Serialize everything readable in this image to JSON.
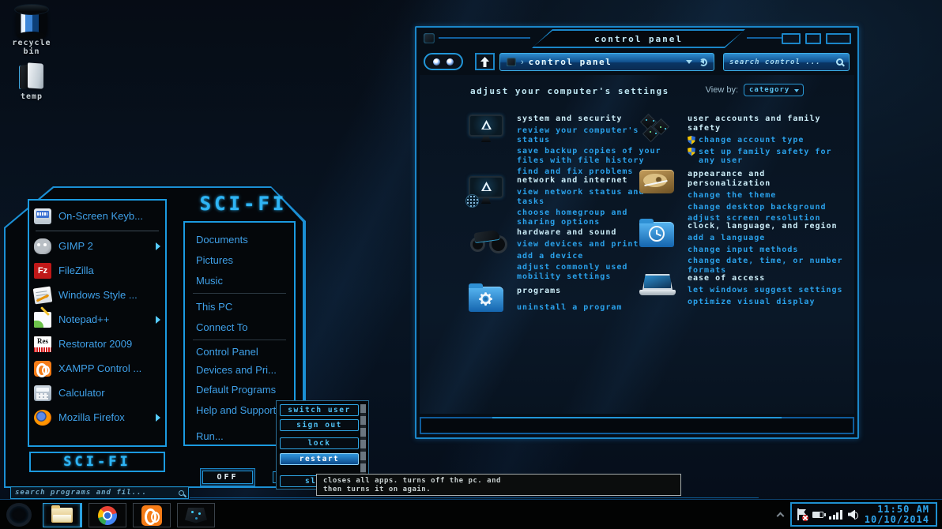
{
  "colors": {
    "accent": "#1e96d8",
    "link": "#2aa1ea",
    "category_title": "#cdeef9",
    "menu_text": "#3fa0e8"
  },
  "desktop": {
    "icons": [
      {
        "label": "recycle bin"
      },
      {
        "label": "temp"
      }
    ]
  },
  "start_menu": {
    "logo": "SCI-FI",
    "footer_logo": "SCI-FI",
    "off_button": "OFF",
    "search_placeholder": "search programs and fil...",
    "programs": [
      {
        "label": "On-Screen Keyb...",
        "icon": "on-screen-keyboard-icon",
        "has_submenu": false
      },
      {
        "label": "GIMP 2",
        "icon": "gimp-icon",
        "has_submenu": true
      },
      {
        "label": "FileZilla",
        "icon": "filezilla-icon",
        "has_submenu": false
      },
      {
        "label": "Windows Style ...",
        "icon": "windows-style-icon",
        "has_submenu": false
      },
      {
        "label": "Notepad++",
        "icon": "notepad-plus-plus-icon",
        "has_submenu": true
      },
      {
        "label": "Restorator 2009",
        "icon": "restorator-icon",
        "has_submenu": false
      },
      {
        "label": "XAMPP Control ...",
        "icon": "xampp-icon",
        "has_submenu": false
      },
      {
        "label": "Calculator",
        "icon": "calculator-icon",
        "has_submenu": false
      },
      {
        "label": "Mozilla Firefox",
        "icon": "firefox-icon",
        "has_submenu": true
      }
    ],
    "places": [
      "Documents",
      "Pictures",
      "Music",
      "This PC",
      "Connect To",
      "Control Panel",
      "Devices and Pri...",
      "Default Programs",
      "Help and Support",
      "Run..."
    ]
  },
  "power_menu": {
    "items": [
      "switch user",
      "sign out",
      "lock",
      "restart",
      "sleep"
    ],
    "highlighted": "restart"
  },
  "tooltip": {
    "text": "closes all apps. turns off the pc. and then turns it on again."
  },
  "control_panel": {
    "title": "control panel",
    "address": "control panel",
    "search_placeholder": "search control ...",
    "header": "adjust your computer's settings",
    "view_by_label": "View by:",
    "view_by_value": "category",
    "categories_left": [
      {
        "title": "system and security",
        "icon": "monitor-shield-icon",
        "links": [
          "review your computer's status",
          "save backup copies of your files with file history",
          "find and fix problems"
        ]
      },
      {
        "title": "network and internet",
        "icon": "monitor-globe-icon",
        "links": [
          "view network status and tasks",
          "choose homegroup and sharing options"
        ]
      },
      {
        "title": "hardware and sound",
        "icon": "vehicle-icon",
        "links": [
          "view devices and printers",
          "add a device",
          "adjust commonly used mobility settings"
        ]
      },
      {
        "title": "programs",
        "icon": "folder-gear-icon",
        "links": [
          "uninstall a program"
        ]
      }
    ],
    "categories_right": [
      {
        "title": "user accounts and family safety",
        "icon": "user-chips-icon",
        "links": [
          "change account type",
          "set up family safety for any user"
        ]
      },
      {
        "title": "appearance and personalization",
        "icon": "palette-icon",
        "links": [
          "change the theme",
          "change desktop background",
          "adjust screen resolution"
        ]
      },
      {
        "title": "clock, language, and region",
        "icon": "folder-clock-icon",
        "links": [
          "add a language",
          "change input methods",
          "change date, time, or number formats"
        ]
      },
      {
        "title": "ease of access",
        "icon": "laptop-icon",
        "links": [
          "let windows suggest settings",
          "optimize visual display"
        ]
      }
    ]
  },
  "taskbar": {
    "clock": {
      "time": "11:50 AM",
      "date": "10/10/2014"
    }
  }
}
